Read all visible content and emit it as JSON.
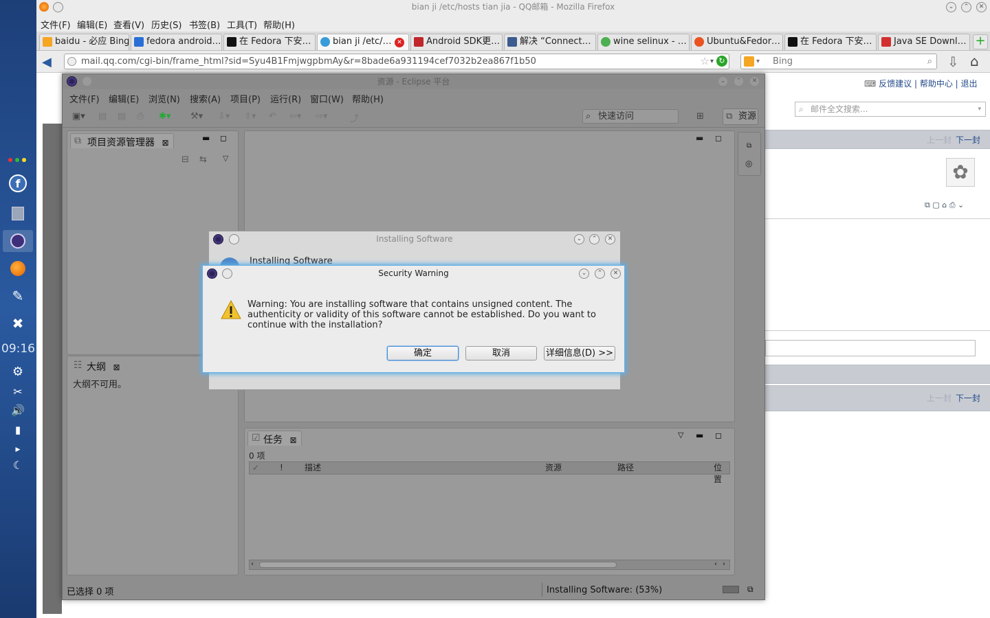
{
  "window_title": "bian ji /etc/hosts tian jia - QQ邮箱 - Mozilla Firefox",
  "firefox_menu": [
    "文件(F)",
    "编辑(E)",
    "查看(V)",
    "历史(S)",
    "书签(B)",
    "工具(T)",
    "帮助(H)"
  ],
  "tabs": [
    {
      "label": "baidu - 必应 Bing",
      "color": "#f5a623"
    },
    {
      "label": "fedora android…",
      "color": "#2b6fd6"
    },
    {
      "label": "在 Fedora 下安…",
      "color": "#111111"
    },
    {
      "label": "bian ji /etc/…",
      "color": "#3a9bd9"
    },
    {
      "label": "Android SDK更…",
      "color": "#c0262c"
    },
    {
      "label": "解决 “Connect…",
      "color": "#3b5b8f"
    },
    {
      "label": "wine selinux - …",
      "color": "#4caf50"
    },
    {
      "label": "Ubuntu&Fedor…",
      "color": "#e95420"
    },
    {
      "label": "在 Fedora 下安…",
      "color": "#111111"
    },
    {
      "label": "Java SE Downl…",
      "color": "#d32f2f"
    }
  ],
  "url": "mail.qq.com/cgi-bin/frame_html?sid=Syu4B1FmjwgpbmAy&r=8bade6a931194cef7032b2ea867f1b50",
  "search_engine": "Bing",
  "qqmail": {
    "top_links": "反馈建议 | 帮助中心 | 退出",
    "search_placeholder": "邮件全文搜索...",
    "prev": "上一封",
    "next": "下一封"
  },
  "dock_clock": "09:16",
  "eclipse": {
    "title": "资源 - Eclipse 平台",
    "menu": [
      "文件(F)",
      "编辑(E)",
      "浏览(N)",
      "搜索(A)",
      "项目(P)",
      "运行(R)",
      "窗口(W)",
      "帮助(H)"
    ],
    "quick_access": "快速访问",
    "perspective": "资源",
    "project_explorer": "项目资源管理器",
    "outline": "大纲",
    "outline_msg": "大纲不可用。",
    "tasks": "任务",
    "tasks_count": "0 项",
    "task_columns": [
      "✓",
      "!",
      "描述",
      "资源",
      "路径",
      "位置"
    ],
    "status_left": "已选择 0 项",
    "status_right": "Installing Software: (53%)"
  },
  "installing_dialog": {
    "title": "Installing Software",
    "heading": "Installing Software"
  },
  "security_dialog": {
    "title": "Security Warning",
    "message": "Warning: You are installing software that contains unsigned content. The authenticity or validity of this software cannot be established. Do you want to continue with the installation?",
    "ok": "确定",
    "cancel": "取消",
    "details": "详细信息(D) >>"
  }
}
